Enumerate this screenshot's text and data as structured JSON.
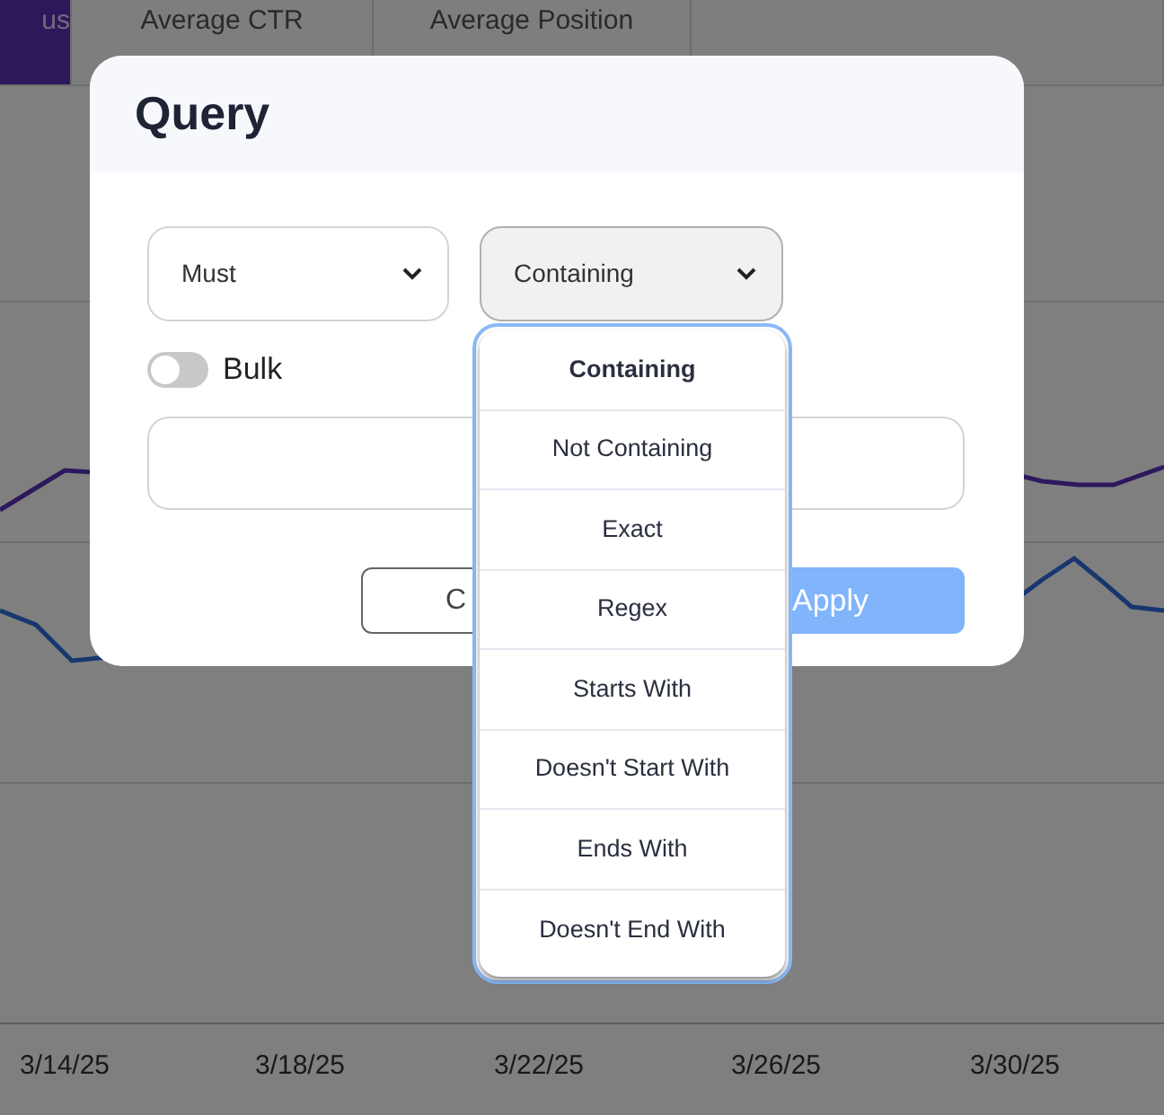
{
  "tabs": [
    {
      "label": "us",
      "selected": true
    },
    {
      "label": "Average CTR",
      "selected": false
    },
    {
      "label": "Average Position",
      "selected": false
    },
    {
      "selected": false
    }
  ],
  "chart": {
    "x_labels": [
      "3/14/25",
      "3/18/25",
      "3/22/25",
      "3/26/25",
      "3/30/25"
    ]
  },
  "dialog": {
    "title": "Query",
    "match_select": {
      "value": "Must"
    },
    "condition_select": {
      "value": "Containing",
      "expanded": true
    },
    "bulk_toggle": {
      "label": "Bulk",
      "on": false
    },
    "options": [
      {
        "label": "Containing",
        "selected": true
      },
      {
        "label": "Not Containing",
        "selected": false
      },
      {
        "label": "Exact",
        "selected": false
      },
      {
        "label": "Regex",
        "selected": false
      },
      {
        "label": "Starts With",
        "selected": false
      },
      {
        "label": "Doesn't Start With",
        "selected": false
      },
      {
        "label": "Ends With",
        "selected": false
      },
      {
        "label": "Doesn't End With",
        "selected": false
      }
    ],
    "buttons": [
      {
        "kind": "secondary",
        "label": "C"
      },
      {
        "kind": "primary",
        "label": "Apply"
      }
    ]
  }
}
